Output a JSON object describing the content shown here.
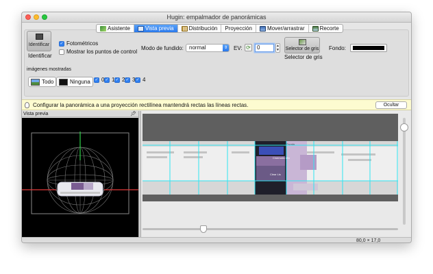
{
  "window": {
    "title": "Hugin: empalmador de panorámicas"
  },
  "tabs": [
    {
      "label": "Asistente",
      "icon": "wand-icon",
      "active": false
    },
    {
      "label": "Vista previa",
      "icon": "monitor-icon",
      "active": true
    },
    {
      "label": "Distribución",
      "icon": "grid-icon",
      "active": false
    },
    {
      "label": "Proyección",
      "icon": "",
      "active": false
    },
    {
      "label": "Mover/arrastrar",
      "icon": "move-icon",
      "active": false
    },
    {
      "label": "Recorte",
      "icon": "crop-icon",
      "active": false
    }
  ],
  "toolbar": {
    "identify_button_label": "Identificar",
    "identify_label": "Identificar",
    "photometric_label": "Fotométricos",
    "photometric_checked": true,
    "control_points_label": "Mostrar los puntos de control",
    "control_points_checked": false,
    "blend_mode_label": "Modo de fundido:",
    "blend_mode_value": "normal",
    "ev_label": "EV:",
    "ev_value": "0",
    "grey_selector_button_label": "Selector de gris",
    "grey_selector_label": "Selector de gris",
    "background_label": "Fondo:",
    "background_color": "#000000"
  },
  "images_section": {
    "title": "imágenes mostradas",
    "all_label": "Todo",
    "none_label": "Ninguna",
    "images": [
      {
        "label": "0",
        "checked": true
      },
      {
        "label": "1",
        "checked": true
      },
      {
        "label": "2",
        "checked": true
      },
      {
        "label": "3",
        "checked": true
      },
      {
        "label": "4",
        "checked": true
      }
    ]
  },
  "infobar": {
    "message": "Configurar la panorámica a una proyección rectilínea mantendrá rectas las líneas rectas.",
    "hide_label": "Ocultar"
  },
  "left_panel": {
    "title": "Vista previa"
  },
  "preview_overlay": {
    "mock_title": "Cinematic Mix",
    "mock_menu": "Escala",
    "mock_footer": "Clear Lis"
  },
  "status": {
    "fov": "80,0 × 17,0"
  },
  "colors": {
    "accent": "#2f7ff0",
    "guide_cyan": "#2ee6f2",
    "axis_red": "#e23a3a",
    "axis_green": "#2fd24a"
  }
}
